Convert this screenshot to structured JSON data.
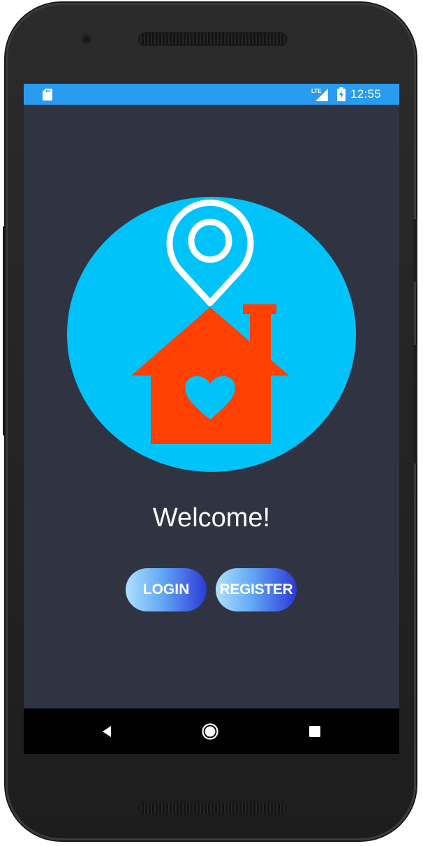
{
  "status_bar": {
    "time": "12:55",
    "network_label": "LTE",
    "icons": [
      "sd-card-icon",
      "lte-signal-icon",
      "battery-charging-icon"
    ]
  },
  "app": {
    "logo_icons": [
      "location-pin-icon",
      "house-icon",
      "heart-icon"
    ],
    "welcome_text": "Welcome!",
    "login_label": "LOGIN",
    "register_label": "REGISTER"
  },
  "nav_bar": {
    "icons": [
      "back-icon",
      "home-icon",
      "recents-icon"
    ]
  },
  "colors": {
    "screen_background": "#303442",
    "status_bar": "#2a9cf0",
    "logo_circle": "#00c3fa",
    "house": "#ff4000",
    "button_gradient_start": "#aee0ff",
    "button_gradient_end": "#2b39d8"
  }
}
